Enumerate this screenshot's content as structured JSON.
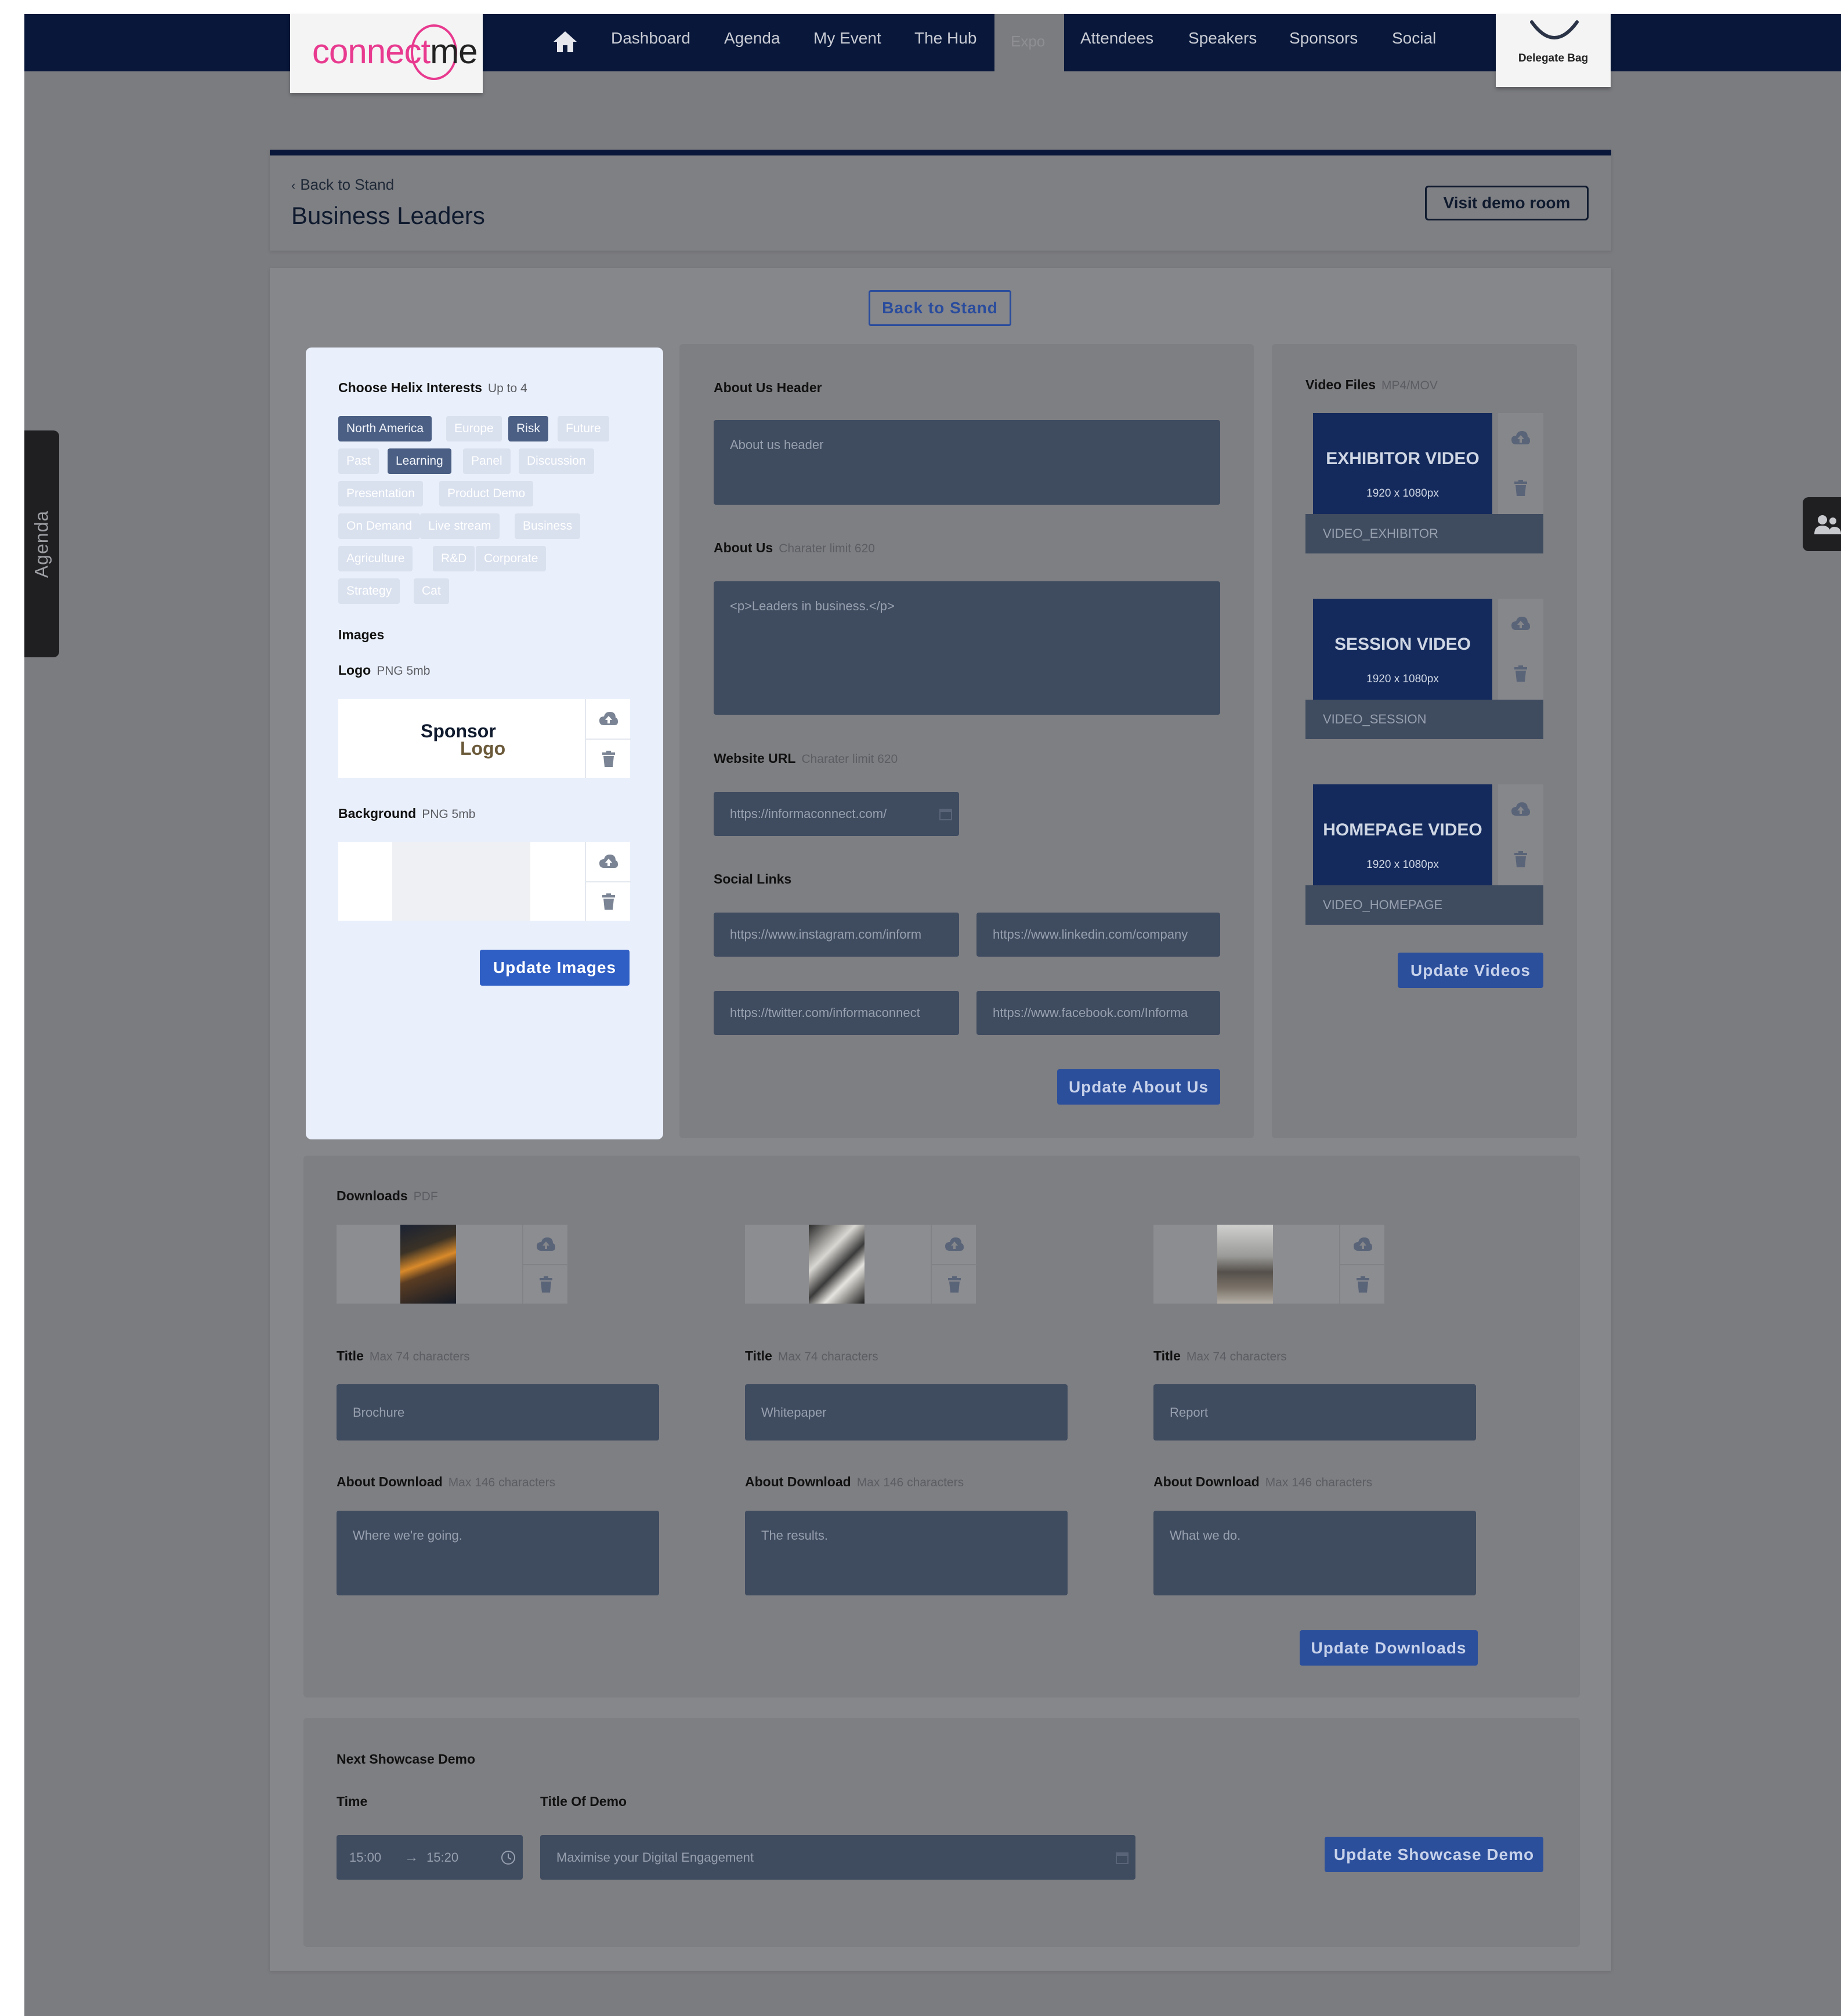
{
  "logo": {
    "text_a": "connect",
    "text_b": "me"
  },
  "nav": {
    "items": [
      "Dashboard",
      "Agenda",
      "My Event",
      "The Hub",
      "Expo",
      "Attendees",
      "Speakers",
      "Sponsors",
      "Social"
    ],
    "delegate_bag": "Delegate Bag"
  },
  "side_tab": {
    "label": "Agenda"
  },
  "header": {
    "back_link": "Back to Stand",
    "title": "Business Leaders",
    "visit_button": "Visit demo room"
  },
  "main": {
    "back_button": "Back to Stand"
  },
  "interests": {
    "title": "Choose Helix Interests",
    "hint": "Up to 4",
    "tags": [
      {
        "label": "North America",
        "selected": true
      },
      {
        "label": "Europe",
        "selected": false
      },
      {
        "label": "Risk",
        "selected": true
      },
      {
        "label": "Future",
        "selected": false
      },
      {
        "label": "Past",
        "selected": false
      },
      {
        "label": "Learning",
        "selected": true
      },
      {
        "label": "Panel",
        "selected": false
      },
      {
        "label": "Discussion",
        "selected": false
      },
      {
        "label": "Presentation",
        "selected": false
      },
      {
        "label": "Product Demo",
        "selected": false
      },
      {
        "label": "On Demand",
        "selected": false
      },
      {
        "label": "Live stream",
        "selected": false
      },
      {
        "label": "Business",
        "selected": false
      },
      {
        "label": "Agriculture",
        "selected": false
      },
      {
        "label": "R&D",
        "selected": false
      },
      {
        "label": "Corporate",
        "selected": false
      },
      {
        "label": "Strategy",
        "selected": false
      },
      {
        "label": "Cat",
        "selected": false
      }
    ]
  },
  "images": {
    "title": "Images",
    "logo_label": "Logo",
    "logo_hint": "PNG 5mb",
    "logo_text_a": "Sponsor",
    "logo_text_b": "Logo",
    "background_label": "Background",
    "background_hint": "PNG 5mb",
    "update_button": "Update Images"
  },
  "about": {
    "header_label": "About Us Header",
    "header_placeholder": "About us header",
    "about_label": "About Us",
    "about_hint": "Charater limit 620",
    "about_value": "<p>Leaders in business.</p>",
    "website_label": "Website URL",
    "website_hint": "Charater limit 620",
    "website_value": "https://informaconnect.com/",
    "social_label": "Social Links",
    "social": [
      "https://www.instagram.com/inform",
      "https://www.linkedin.com/company",
      "https://twitter.com/informaconnect",
      "https://www.facebook.com/Informa"
    ],
    "update_button": "Update About Us"
  },
  "videos": {
    "title": "Video Files",
    "hint": "MP4/MOV",
    "items": [
      {
        "title": "EXHIBITOR VIDEO",
        "size": "1920 x 1080px",
        "name": "VIDEO_EXHIBITOR"
      },
      {
        "title": "SESSION VIDEO",
        "size": "1920 x 1080px",
        "name": "VIDEO_SESSION"
      },
      {
        "title": "HOMEPAGE VIDEO",
        "size": "1920 x 1080px",
        "name": "VIDEO_HOMEPAGE"
      }
    ],
    "update_button": "Update Videos"
  },
  "downloads": {
    "title": "Downloads",
    "hint": "PDF",
    "title_label": "Title",
    "title_hint": "Max 74 characters",
    "about_label": "About Download",
    "about_hint": "Max 146 characters",
    "items": [
      {
        "title": "Brochure",
        "about": "Where we're going."
      },
      {
        "title": "Whitepaper",
        "about": "The results."
      },
      {
        "title": "Report",
        "about": "What we do."
      }
    ],
    "update_button": "Update Downloads"
  },
  "showcase": {
    "title": "Next Showcase Demo",
    "time_label": "Time",
    "time_start": "15:00",
    "time_end": "15:20",
    "demo_label": "Title Of Demo",
    "demo_value": "Maximise your Digital Engagement",
    "update_button": "Update Showcase Demo"
  },
  "colors": {
    "nav_bg": "#08173a",
    "accent": "#e83a8f",
    "button_blue": "#2f5ec4",
    "field_bg": "#3f4b5f"
  },
  "icons": [
    "home-icon",
    "bag-icon",
    "upload-cloud-icon",
    "trash-icon",
    "calendar-icon",
    "clock-icon",
    "people-icon",
    "chevron-left-icon",
    "arrow-right-icon"
  ]
}
